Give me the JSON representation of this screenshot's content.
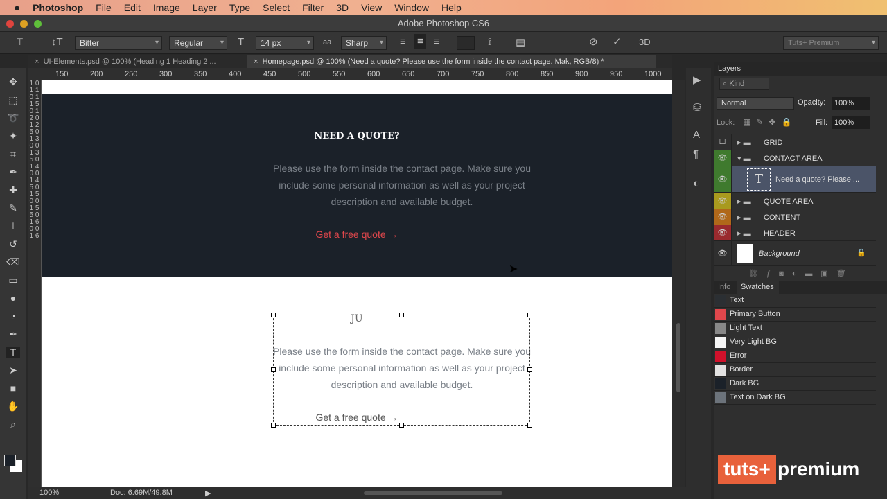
{
  "menubar": {
    "app": "Photoshop",
    "items": [
      "File",
      "Edit",
      "Image",
      "Layer",
      "Type",
      "Select",
      "Filter",
      "3D",
      "View",
      "Window",
      "Help"
    ]
  },
  "window_title": "Adobe Photoshop CS6",
  "options": {
    "font_family": "Bitter",
    "font_style": "Regular",
    "font_size": "14 px",
    "antialias_label": "aa",
    "antialias": "Sharp",
    "workspace": "Tuts+ Premium",
    "threed": "3D"
  },
  "tabs": [
    {
      "label": "UI-Elements.psd @ 100% (Heading 1 Heading 2 ..."
    },
    {
      "label": "Homepage.psd @ 100% (Need a quote?  Please use the form inside the contact page. Mak, RGB/8) *"
    }
  ],
  "ruler": [
    "150",
    "200",
    "250",
    "300",
    "350",
    "400",
    "450",
    "500",
    "550",
    "600",
    "650",
    "700",
    "750",
    "800",
    "850",
    "900",
    "950",
    "1000"
  ],
  "vruler": "1 0 1 1 0 1 1 5 0 1 2 0 1 2 5 0 1 3 0 0 1 3 5 0 1 4 0 0 1 4 5 0 1 5 0 0 1 5 5 0 1 6 0 0 1 6",
  "canvas": {
    "heading": "NEED A QUOTE?",
    "paragraph": "Please use the form inside the contact page. Make sure you include some personal information as well as your project description and available budget.",
    "link": "Get a free quote →",
    "editing_text": "JU",
    "colors": {
      "dark_bg": "#1b2129",
      "link": "#e0474c"
    }
  },
  "status": {
    "zoom": "100%",
    "doc": "Doc: 6.69M/49.8M"
  },
  "layers_panel": {
    "title": "Layers",
    "filter": "Kind",
    "blend": "Normal",
    "opacity_label": "Opacity:",
    "opacity": "100%",
    "lock_label": "Lock:",
    "fill_label": "Fill:",
    "fill": "100%",
    "layers": [
      {
        "name": "GRID",
        "color": "",
        "visible": false
      },
      {
        "name": "CONTACT AREA",
        "color": "#3f7a2e",
        "visible": true
      },
      {
        "name": "Need a quote?  Please ...",
        "color": "#3f7a2e",
        "visible": true
      },
      {
        "name": "QUOTE AREA",
        "color": "#a89a1e",
        "visible": true
      },
      {
        "name": "CONTENT",
        "color": "#b0681a",
        "visible": true
      },
      {
        "name": "HEADER",
        "color": "#9a2a2e",
        "visible": true
      },
      {
        "name": "Background",
        "color": "",
        "visible": true
      }
    ]
  },
  "swatches_panel": {
    "tabs": [
      "Info",
      "Swatches"
    ],
    "swatches": [
      {
        "name": "Text",
        "color": "#2b2f33"
      },
      {
        "name": "Primary Button",
        "color": "#e0474c"
      },
      {
        "name": "Light Text",
        "color": "#888888"
      },
      {
        "name": "Very Light BG",
        "color": "#f5f5f5"
      },
      {
        "name": "Error",
        "color": "#d0112b"
      },
      {
        "name": "Border",
        "color": "#e2e2e2"
      },
      {
        "name": "Dark BG",
        "color": "#1b2129"
      },
      {
        "name": "Text on Dark BG",
        "color": "#6c737b"
      }
    ]
  },
  "watermark": {
    "a": "tuts+",
    "b": "premium"
  }
}
